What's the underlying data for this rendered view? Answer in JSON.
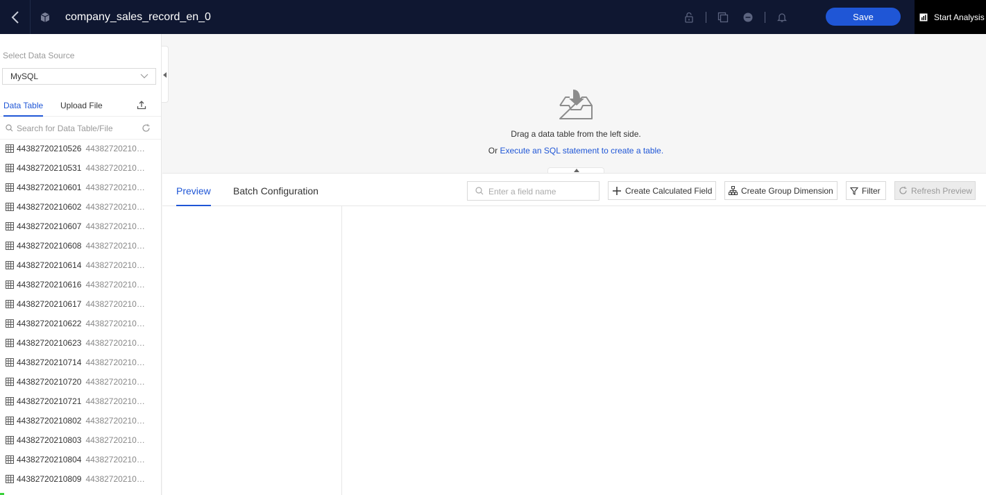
{
  "topbar": {
    "title": "company_sales_record_en_0",
    "save_label": "Save",
    "start_analysis_label": "Start Analysis"
  },
  "sidebar": {
    "data_source_label": "Select Data Source",
    "data_source_value": "MySQL",
    "tabs": [
      {
        "label": "Data Table",
        "active": true
      },
      {
        "label": "Upload File",
        "active": false
      }
    ],
    "search_placeholder": "Search for Data Table/File",
    "tables": [
      {
        "name": "44382720210526",
        "alias": "44382720210526"
      },
      {
        "name": "44382720210531",
        "alias": "44382720210531"
      },
      {
        "name": "44382720210601",
        "alias": "44382720210601"
      },
      {
        "name": "44382720210602",
        "alias": "44382720210602"
      },
      {
        "name": "44382720210607",
        "alias": "44382720210607"
      },
      {
        "name": "44382720210608",
        "alias": "44382720210608"
      },
      {
        "name": "44382720210614",
        "alias": "44382720210614"
      },
      {
        "name": "44382720210616",
        "alias": "44382720210616"
      },
      {
        "name": "44382720210617",
        "alias": "44382720210617"
      },
      {
        "name": "44382720210622",
        "alias": "44382720210622"
      },
      {
        "name": "44382720210623",
        "alias": "44382720210623"
      },
      {
        "name": "44382720210714",
        "alias": "44382720210714"
      },
      {
        "name": "44382720210720",
        "alias": "44382720210720"
      },
      {
        "name": "44382720210721",
        "alias": "44382720210721"
      },
      {
        "name": "44382720210802",
        "alias": "44382720210802"
      },
      {
        "name": "44382720210803",
        "alias": "44382720210803"
      },
      {
        "name": "44382720210804",
        "alias": "44382720210804"
      },
      {
        "name": "44382720210809",
        "alias": "44382720210809"
      }
    ]
  },
  "drop_area": {
    "hint": "Drag a data table from the left side.",
    "or_label": "Or",
    "sql_link": "Execute an SQL statement to create a table."
  },
  "lower": {
    "tabs": [
      {
        "label": "Preview",
        "active": true
      },
      {
        "label": "Batch Configuration",
        "active": false
      }
    ],
    "field_search_placeholder": "Enter a field name",
    "create_calculated_field": "Create Calculated Field",
    "create_group_dimension": "Create Group Dimension",
    "filter": "Filter",
    "refresh_preview": "Refresh Preview"
  },
  "colors": {
    "topbar_bg": "#0f1731",
    "accent": "#1f56d6"
  }
}
